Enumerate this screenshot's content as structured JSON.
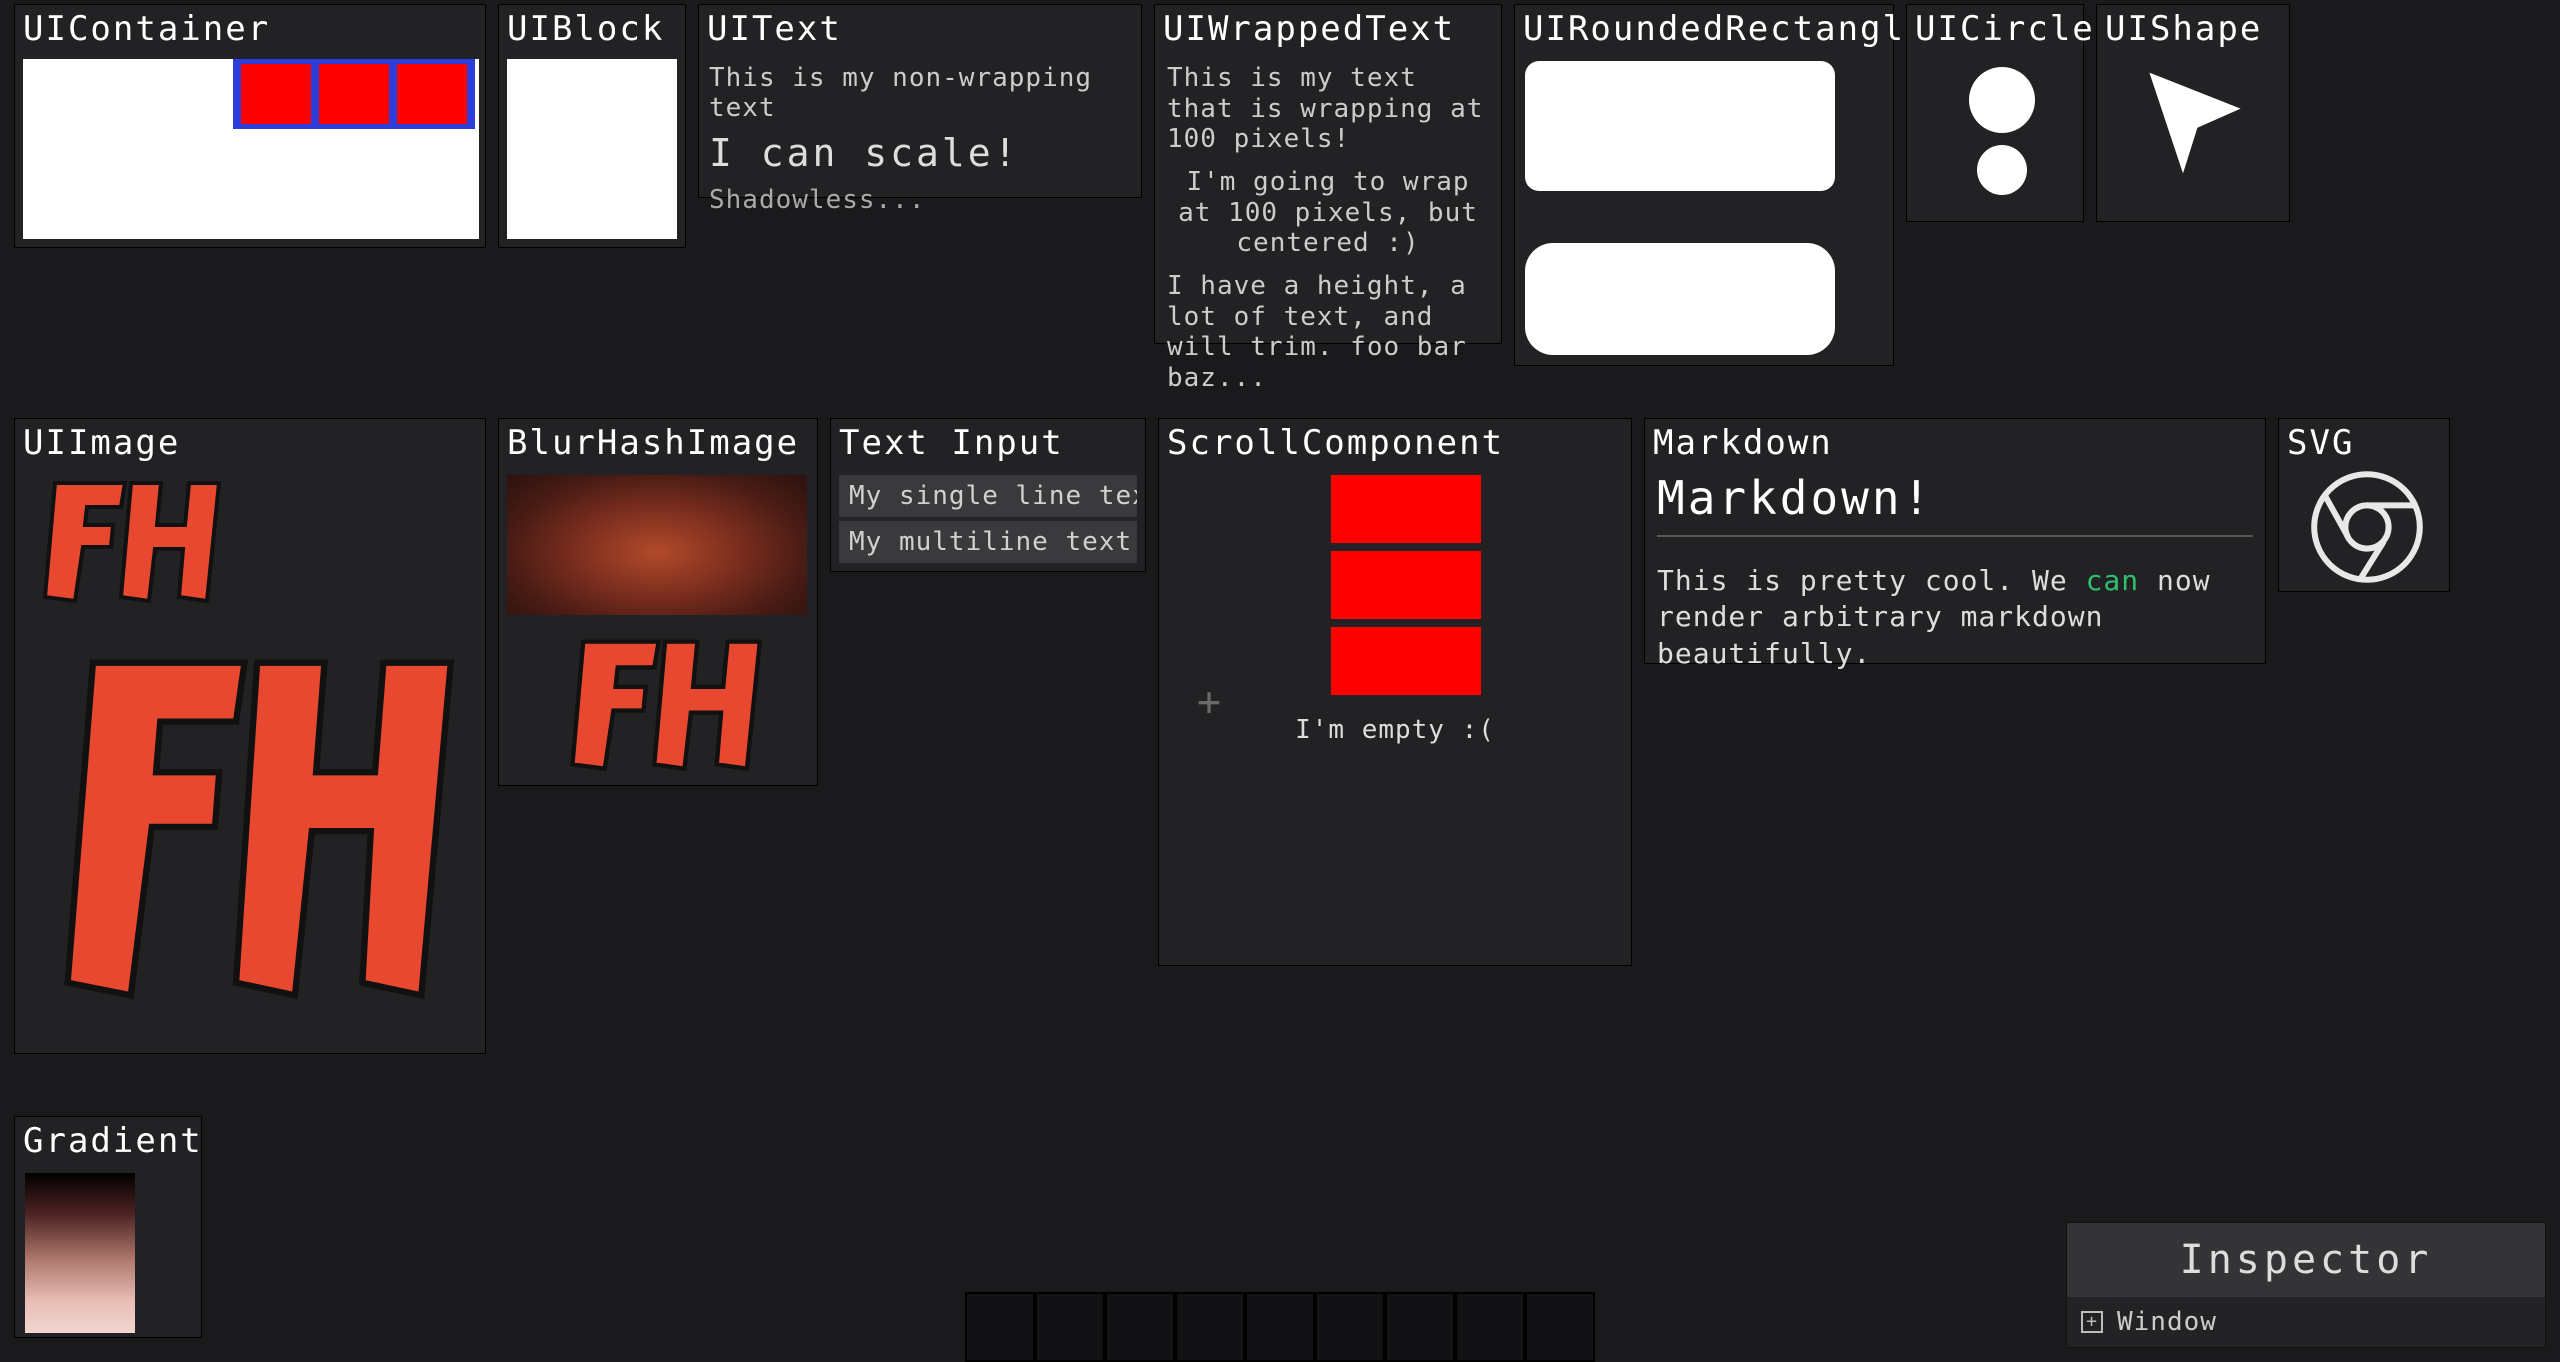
{
  "panels": {
    "ui_container": {
      "title": "UIContainer"
    },
    "ui_block": {
      "title": "UIBlock"
    },
    "ui_text": {
      "title": "UIText",
      "line1": "This is my non-wrapping text",
      "line2": "I can scale!",
      "line3": "Shadowless..."
    },
    "ui_wrapped": {
      "title": "UIWrappedText",
      "para1": "This is my text that is wrapping at 100 pixels!",
      "para2": "I'm going to wrap at 100 pixels, but centered :)",
      "para3": "I have a height, a lot of text, and will trim. foo bar baz..."
    },
    "ui_rounded": {
      "title": "UIRoundedRectangle"
    },
    "ui_circle": {
      "title": "UICircle"
    },
    "ui_shape": {
      "title": "UIShape"
    },
    "ui_image": {
      "title": "UIImage",
      "logo_text": "FH"
    },
    "blurhash": {
      "title": "BlurHashImage",
      "logo_text": "FH"
    },
    "text_input": {
      "title": "Text Input",
      "single_line": "My single line text",
      "multi_line": "My multiline text..."
    },
    "scroll": {
      "title": "ScrollComponent",
      "empty_text": "I'm empty :("
    },
    "markdown": {
      "title": "Markdown",
      "heading": "Markdown!",
      "body_pre": "This is pretty cool. We ",
      "body_em": "can",
      "body_post": " now render arbitrary markdown beautifully."
    },
    "svg": {
      "title": "SVG"
    },
    "gradient": {
      "title": "Gradient"
    }
  },
  "inspector": {
    "title": "Inspector",
    "tree_root": "Window"
  },
  "colors": {
    "red": "#ff0000",
    "blue": "#2b3edc",
    "white": "#ffffff",
    "panel_bg": "#222225"
  }
}
